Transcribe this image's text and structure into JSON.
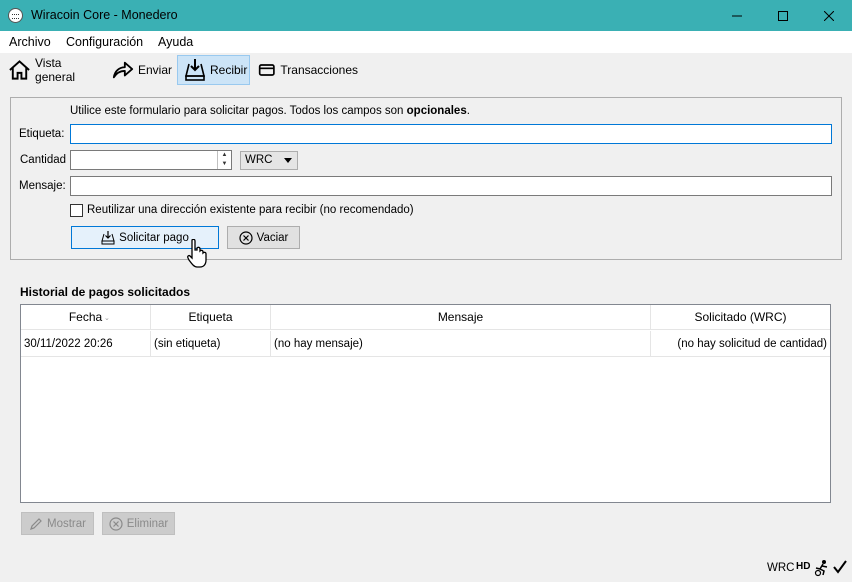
{
  "window": {
    "title": "Wiracoin Core - Monedero"
  },
  "menu": [
    "Archivo",
    "Configuración",
    "Ayuda"
  ],
  "toolbar": {
    "overview": "Vista general",
    "send": "Enviar",
    "receive": "Recibir",
    "transactions": "Transacciones"
  },
  "form": {
    "info_prefix": "Utilice este formulario para solicitar pagos. Todos los campos son ",
    "info_bold": "opcionales",
    "info_suffix": ".",
    "label_label": "Etiqueta:",
    "amount_label": "Cantidad",
    "message_label": "Mensaje:",
    "label_value": "",
    "amount_value": "",
    "message_value": "",
    "unit": "WRC",
    "reuse_checkbox": "Reutilizar una dirección existente para recibir (no recomendado)",
    "reuse_checked": false,
    "request_button": "Solicitar pago",
    "clear_button": "Vaciar"
  },
  "history": {
    "title": "Historial de pagos solicitados",
    "columns": [
      "Fecha",
      "Etiqueta",
      "Mensaje",
      "Solicitado (WRC)"
    ],
    "rows": [
      {
        "date": "30/11/2022 20:26",
        "label": "(sin etiqueta)",
        "message": "(no hay mensaje)",
        "amount": "(no hay solicitud de cantidad)"
      }
    ],
    "show_button": "Mostrar",
    "remove_button": "Eliminar"
  },
  "status": {
    "unit": "WRC",
    "hd": "HD"
  }
}
